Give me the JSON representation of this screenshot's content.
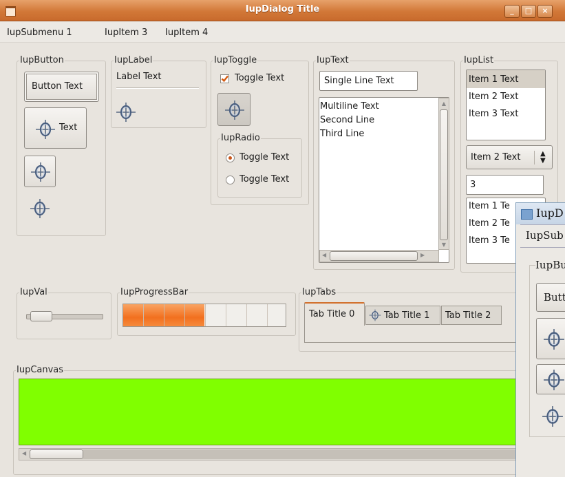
{
  "window": {
    "title": "IupDialog Title",
    "buttons": [
      "_",
      "□",
      "×"
    ]
  },
  "menu": [
    "IupSubmenu 1",
    "IupItem 3",
    "IupItem 4"
  ],
  "button_frame": {
    "legend": "IupButton",
    "button_text": "Button Text",
    "image_text_label": "Text"
  },
  "label_frame": {
    "legend": "IupLabel",
    "label_text": "Label Text"
  },
  "toggle_frame": {
    "legend": "IupToggle",
    "toggle_text": "Toggle Text",
    "toggle_checked": true
  },
  "radio_frame": {
    "legend": "IupRadio",
    "options": [
      "Toggle Text",
      "Toggle Text"
    ],
    "selected_index": 0
  },
  "text_frame": {
    "legend": "IupText",
    "single_line": "Single Line Text",
    "multiline": [
      "Multiline Text",
      "Second Line",
      "Third Line"
    ]
  },
  "list_frame": {
    "legend": "IupList",
    "list1_items": [
      "Item 1 Text",
      "Item 2 Text",
      "Item 3 Text"
    ],
    "list1_selected": 0,
    "dropdown_value": "Item 2 Text",
    "spin_value": "3",
    "list3_items": [
      "Item 1 Te",
      "Item 2 Te",
      "Item 3 Te"
    ]
  },
  "val_frame": {
    "legend": "IupVal",
    "value": 0.08
  },
  "progress_frame": {
    "legend": "IupProgressBar",
    "value": 0.5
  },
  "tabs_frame": {
    "legend": "IupTabs",
    "tabs": [
      "Tab Title 0",
      "Tab Title 1",
      "Tab Title 2"
    ],
    "active": 0
  },
  "canvas_frame": {
    "legend": "IupCanvas",
    "color": "#80ff00"
  },
  "second_window": {
    "title": "IupD",
    "menu": "IupSub",
    "legend": "IupBu",
    "button": "Butt"
  },
  "colors": {
    "accent": "#d27838",
    "canvas": "#80ff00",
    "progress": "#f47b2a"
  },
  "icons": [
    "window-menu-icon",
    "minimize-icon",
    "maximize-icon",
    "close-icon",
    "crosshair-icon"
  ]
}
